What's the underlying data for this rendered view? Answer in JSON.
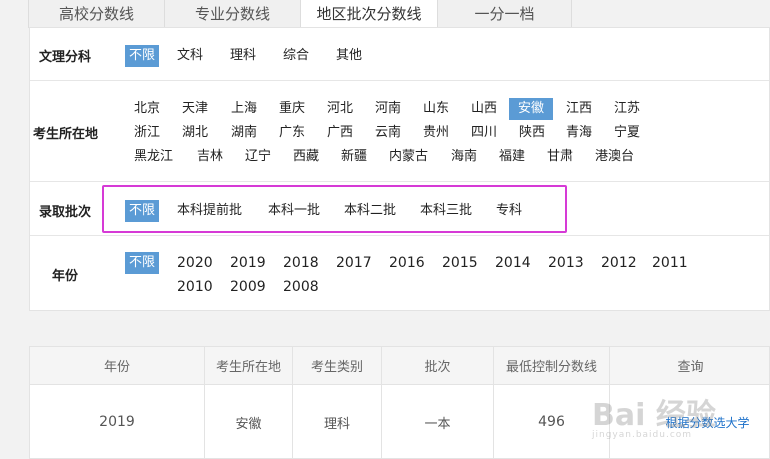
{
  "tabs": [
    {
      "label": "高校分数线"
    },
    {
      "label": "专业分数线"
    },
    {
      "label": "地区批次分数线"
    },
    {
      "label": "一分一档"
    }
  ],
  "filters": {
    "category": {
      "label": "文理分科",
      "options": [
        "不限",
        "文科",
        "理科",
        "综合",
        "其他"
      ]
    },
    "region": {
      "label": "考生所在地",
      "options": [
        "北京",
        "天津",
        "上海",
        "重庆",
        "河北",
        "河南",
        "山东",
        "山西",
        "安徽",
        "江西",
        "江苏",
        "浙江",
        "湖北",
        "湖南",
        "广东",
        "广西",
        "云南",
        "贵州",
        "四川",
        "陕西",
        "青海",
        "宁夏",
        "黑龙江",
        "吉林",
        "辽宁",
        "西藏",
        "新疆",
        "内蒙古",
        "海南",
        "福建",
        "甘肃",
        "港澳台"
      ]
    },
    "batch": {
      "label": "录取批次",
      "options": [
        "不限",
        "本科提前批",
        "本科一批",
        "本科二批",
        "本科三批",
        "专科"
      ]
    },
    "year": {
      "label": "年份",
      "options": [
        "不限",
        "2020",
        "2019",
        "2018",
        "2017",
        "2016",
        "2015",
        "2014",
        "2013",
        "2012",
        "2011",
        "2010",
        "2009",
        "2008"
      ]
    }
  },
  "table": {
    "headers": [
      "年份",
      "考生所在地",
      "考生类别",
      "批次",
      "最低控制分数线",
      "查询"
    ],
    "rows": [
      {
        "year": "2019",
        "region": "安徽",
        "type": "理科",
        "batch": "一本",
        "score": "496",
        "query": "根据分数选大学"
      }
    ]
  },
  "watermark": {
    "text": "Bai 经验",
    "sub": "jingyan.baidu.com"
  },
  "colors": {
    "selected": "#5b9bd5",
    "highlight": "#d63ad6",
    "link": "#1a6fc9"
  }
}
